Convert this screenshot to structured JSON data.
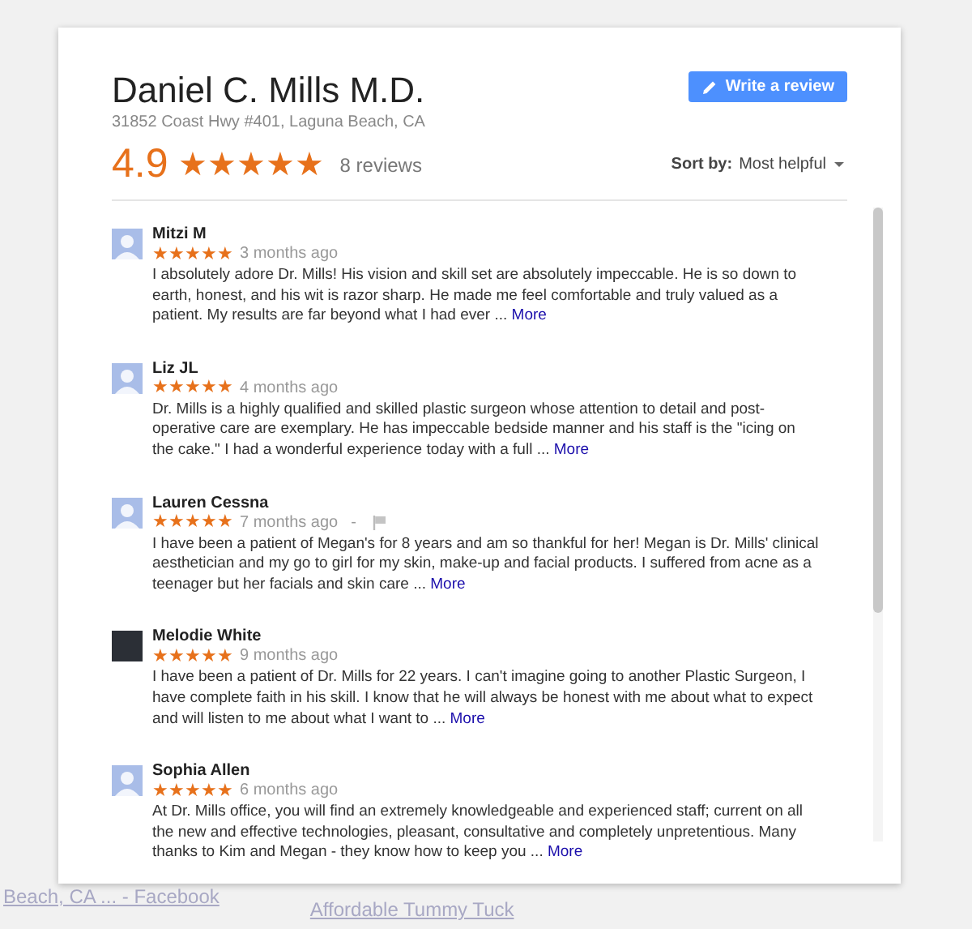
{
  "business": {
    "name": "Daniel C. Mills M.D.",
    "address": "31852 Coast Hwy #401, Laguna Beach, CA",
    "rating": "4.9",
    "stars": 5,
    "review_count": "8 reviews"
  },
  "write_review_button": {
    "label": "Write a review"
  },
  "sort": {
    "label": "Sort by:",
    "value": "Most helpful"
  },
  "reviews": [
    {
      "author": "Mitzi M",
      "kind": "silhouette",
      "stars": 5,
      "time": "3 months ago",
      "flag": false,
      "text": "I absolutely adore Dr. Mills! His vision and skill set are absolutely impeccable. He is so down to earth, honest, and his wit is razor sharp. He made me feel comfortable and truly valued as a patient. My results are far beyond what I had ever ...",
      "more": "More"
    },
    {
      "author": "Liz JL",
      "kind": "silhouette",
      "stars": 5,
      "time": "4 months ago",
      "flag": false,
      "text": "Dr. Mills is a highly qualified and skilled plastic surgeon whose attention to detail and post-operative care are exemplary. He has impeccable bedside manner and his staff is the \"icing on the cake.\" I had a wonderful experience today with a full ...",
      "more": "More"
    },
    {
      "author": "Lauren Cessna",
      "kind": "silhouette",
      "stars": 5,
      "time": "7 months ago",
      "flag": true,
      "separator": "-",
      "text": "I have been a patient of Megan's for 8 years and am so thankful for her! Megan is Dr. Mills' clinical aesthetician and my go to girl for my skin, make-up and facial products. I suffered from acne as a teenager but her facials and skin care ...",
      "more": "More"
    },
    {
      "author": "Melodie White",
      "kind": "photo",
      "stars": 5,
      "time": "9 months ago",
      "flag": false,
      "text": "I have been a patient of Dr. Mills for 22 years. I can't imagine going to another Plastic Surgeon, I have complete faith in his skill. I know that he will always be honest with me about what to expect and will listen to me about what I want to ...",
      "more": "More"
    },
    {
      "author": "Sophia Allen",
      "kind": "silhouette",
      "stars": 5,
      "time": "6 months ago",
      "flag": false,
      "text": "At Dr. Mills office, you will find an extremely knowledgeable and experienced staff; current on all the new and effective technologies, pleasant, consultative and completely unpretentious. Many thanks to Kim and Megan - they know how to keep you ...",
      "more": "More"
    }
  ],
  "background": {
    "links": [
      "Beach, CA ... - Facebook",
      "Affordable Tummy Tuck"
    ]
  }
}
